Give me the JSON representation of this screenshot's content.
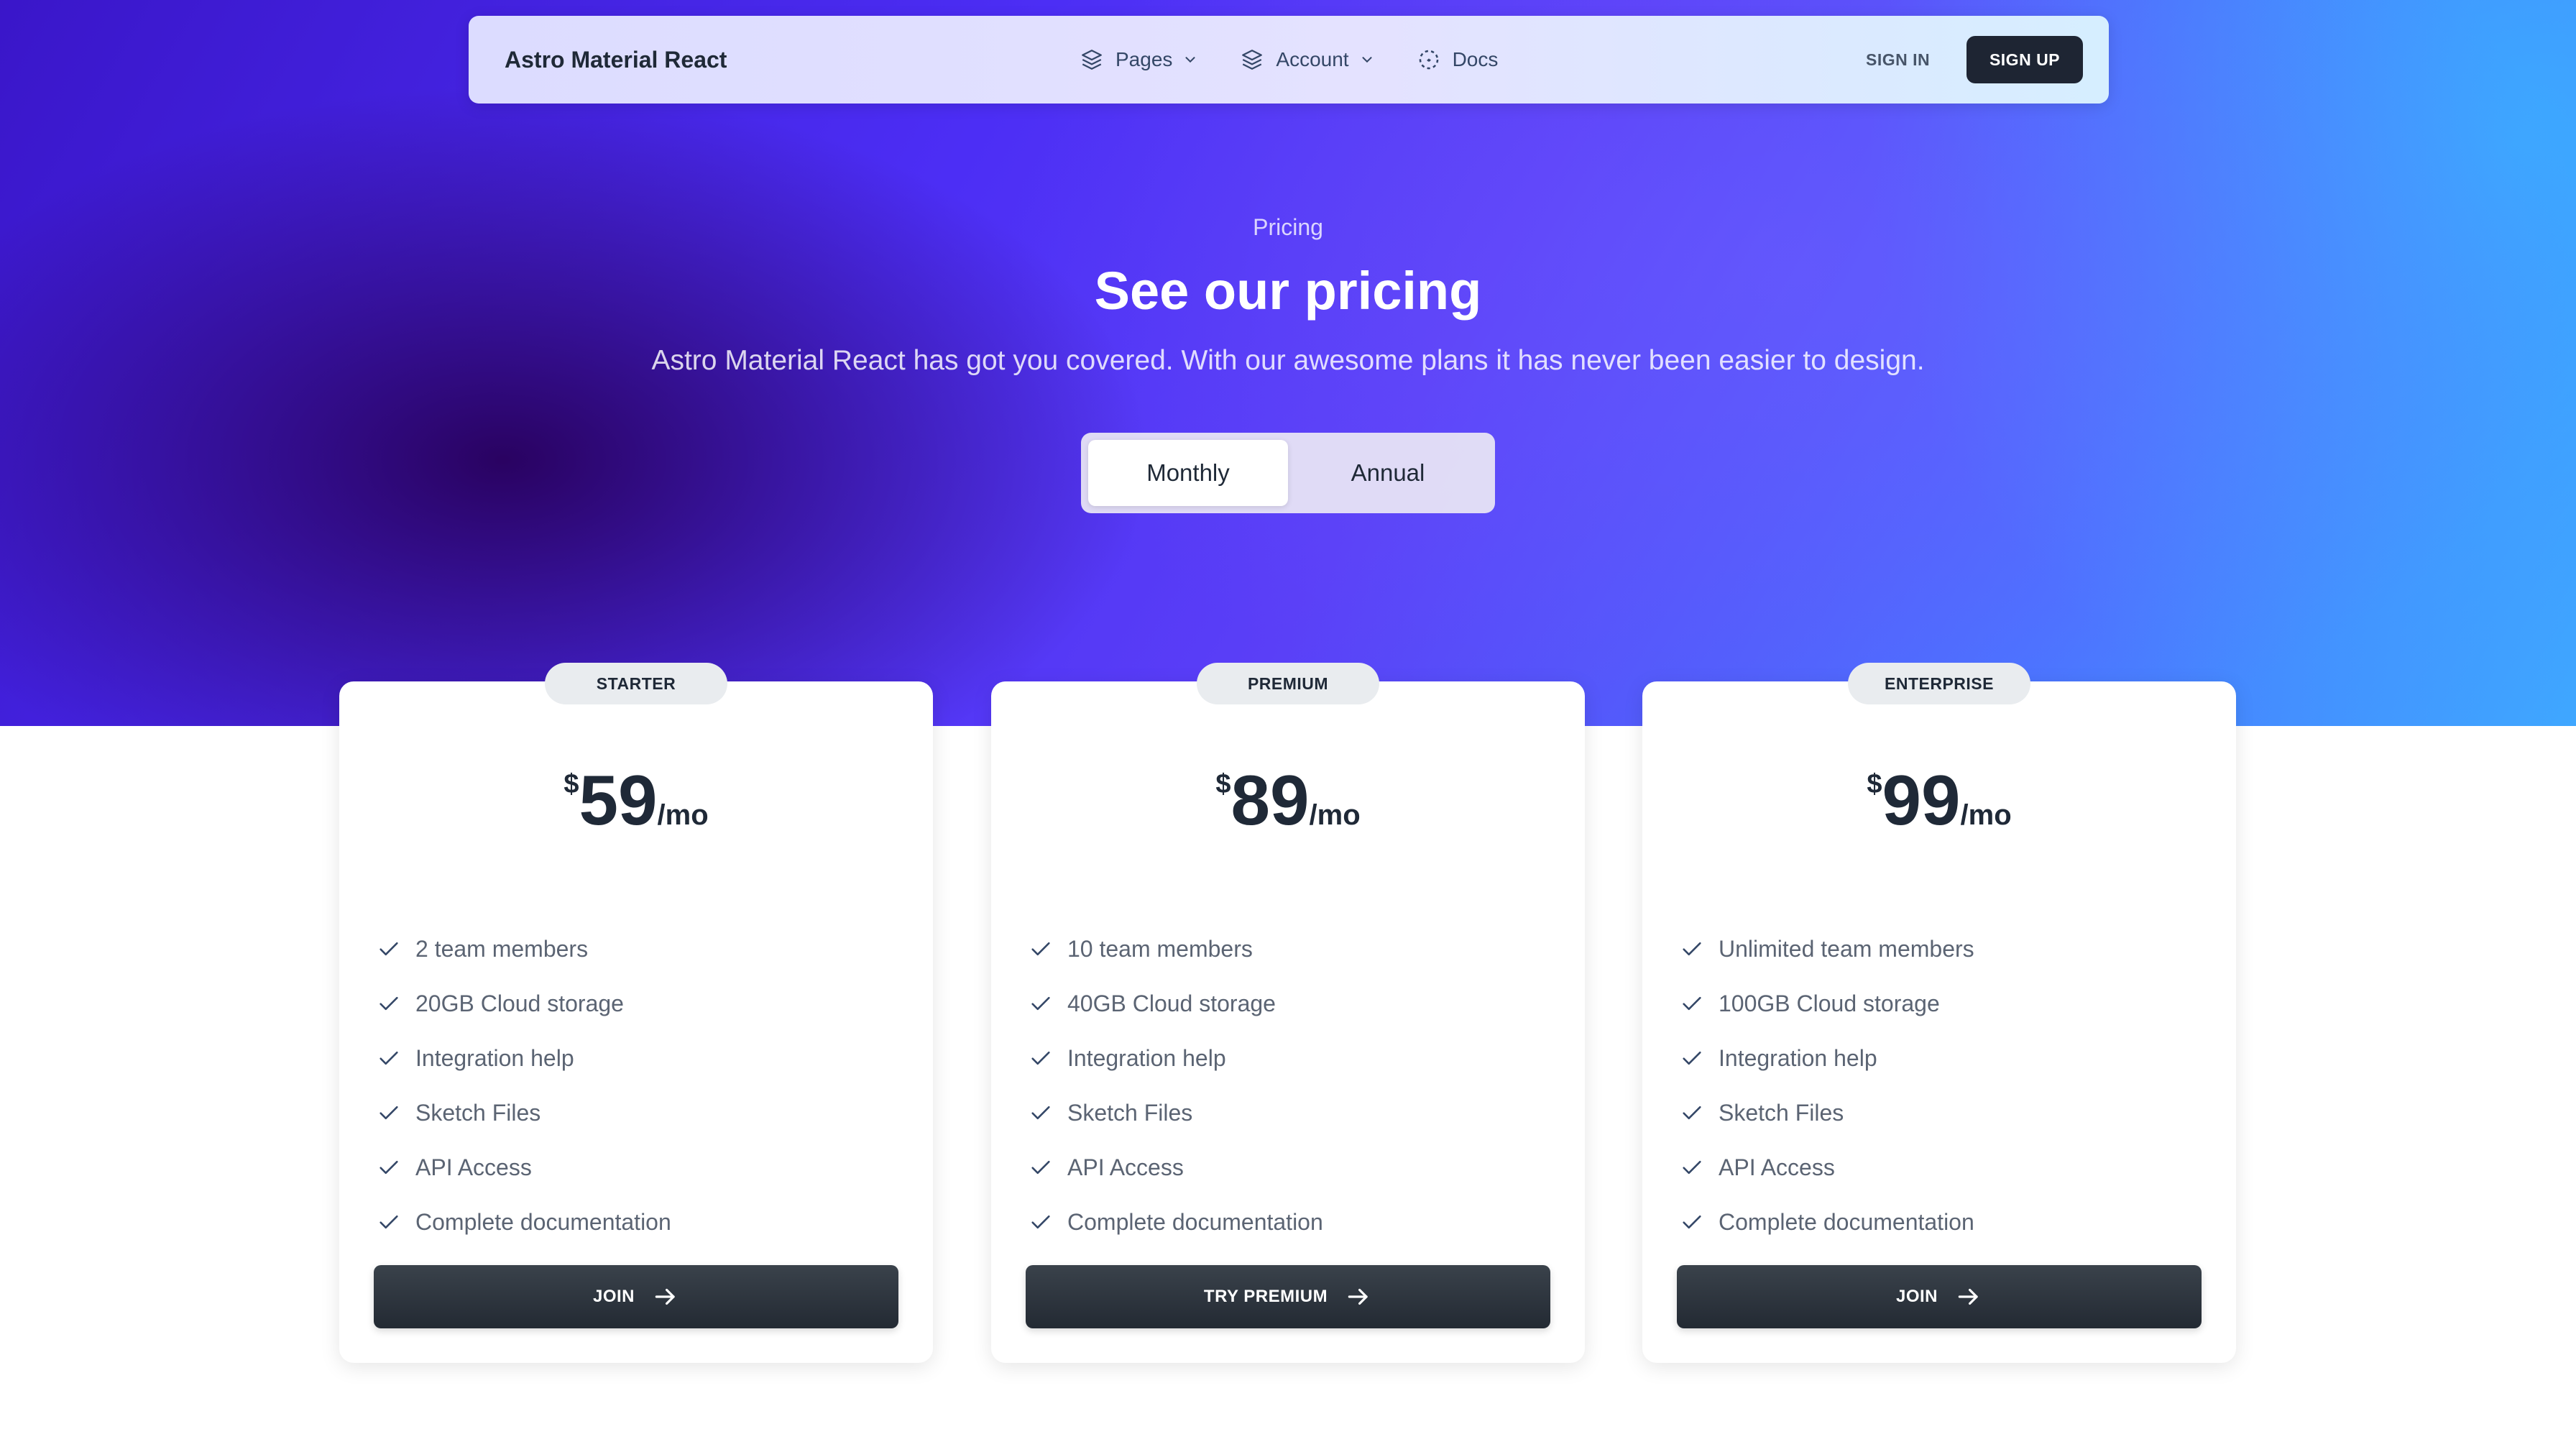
{
  "colors": {
    "hero_gradient": [
      "#3a16c9",
      "#4c2ef5",
      "#4a74ff",
      "#3fa7ff"
    ],
    "primary_dark": "#1e2533",
    "text_dark": "#1f2937"
  },
  "nav": {
    "brand": "Astro Material React",
    "links": [
      {
        "label": "Pages",
        "icon": "layers-icon",
        "dropdown": true
      },
      {
        "label": "Account",
        "icon": "layers-icon",
        "dropdown": true
      },
      {
        "label": "Docs",
        "icon": "dashed-circle-icon",
        "dropdown": false
      }
    ],
    "sign_in": "SIGN IN",
    "sign_up": "SIGN UP"
  },
  "hero": {
    "eyebrow": "Pricing",
    "title": "See our pricing",
    "subtitle": "Astro Material React has got you covered. With our awesome plans it has never been easier to design."
  },
  "billing_toggle": {
    "options": [
      "Monthly",
      "Annual"
    ],
    "selected": "Monthly"
  },
  "plans": [
    {
      "badge": "STARTER",
      "currency": "$",
      "amount": "59",
      "period": "/mo",
      "features": [
        "2 team members",
        "20GB Cloud storage",
        "Integration help",
        "Sketch Files",
        "API Access",
        "Complete documentation"
      ],
      "cta": "JOIN"
    },
    {
      "badge": "PREMIUM",
      "currency": "$",
      "amount": "89",
      "period": "/mo",
      "features": [
        "10 team members",
        "40GB Cloud storage",
        "Integration help",
        "Sketch Files",
        "API Access",
        "Complete documentation"
      ],
      "cta": "TRY PREMIUM"
    },
    {
      "badge": "ENTERPRISE",
      "currency": "$",
      "amount": "99",
      "period": "/mo",
      "features": [
        "Unlimited team members",
        "100GB Cloud storage",
        "Integration help",
        "Sketch Files",
        "API Access",
        "Complete documentation"
      ],
      "cta": "JOIN"
    }
  ]
}
